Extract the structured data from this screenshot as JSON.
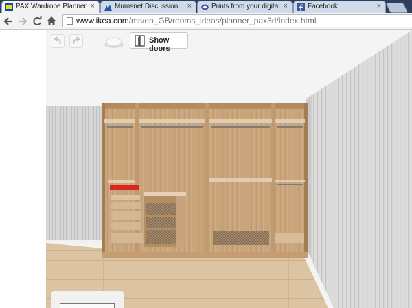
{
  "browser": {
    "tabs": [
      {
        "title": "PAX Wardrobe Planner - I",
        "favicon": "ikea-favicon",
        "active": true
      },
      {
        "title": "Mumsnet Discussion",
        "favicon": "mumsnet-favicon",
        "active": false
      },
      {
        "title": "Prints from your digital p",
        "favicon": "photobox-favicon",
        "active": false
      },
      {
        "title": "Facebook",
        "favicon": "facebook-favicon",
        "active": false
      }
    ],
    "close_glyph": "×",
    "address": {
      "host": "www.ikea.com",
      "path": "/ms/en_GB/rooms_ideas/planner_pax3d/index.html"
    }
  },
  "planner": {
    "undo_icon": "undo-icon",
    "redo_icon": "redo-icon",
    "view_icon": "cloud-view-icon",
    "show_doors_label": "Show doors",
    "show_doors_icon": "doors-icon"
  },
  "colors": {
    "tabstrip": "#2d3e5e",
    "wood": "#c9a57c",
    "wall": "#d9d9d9",
    "floor": "#dcc3a2"
  }
}
